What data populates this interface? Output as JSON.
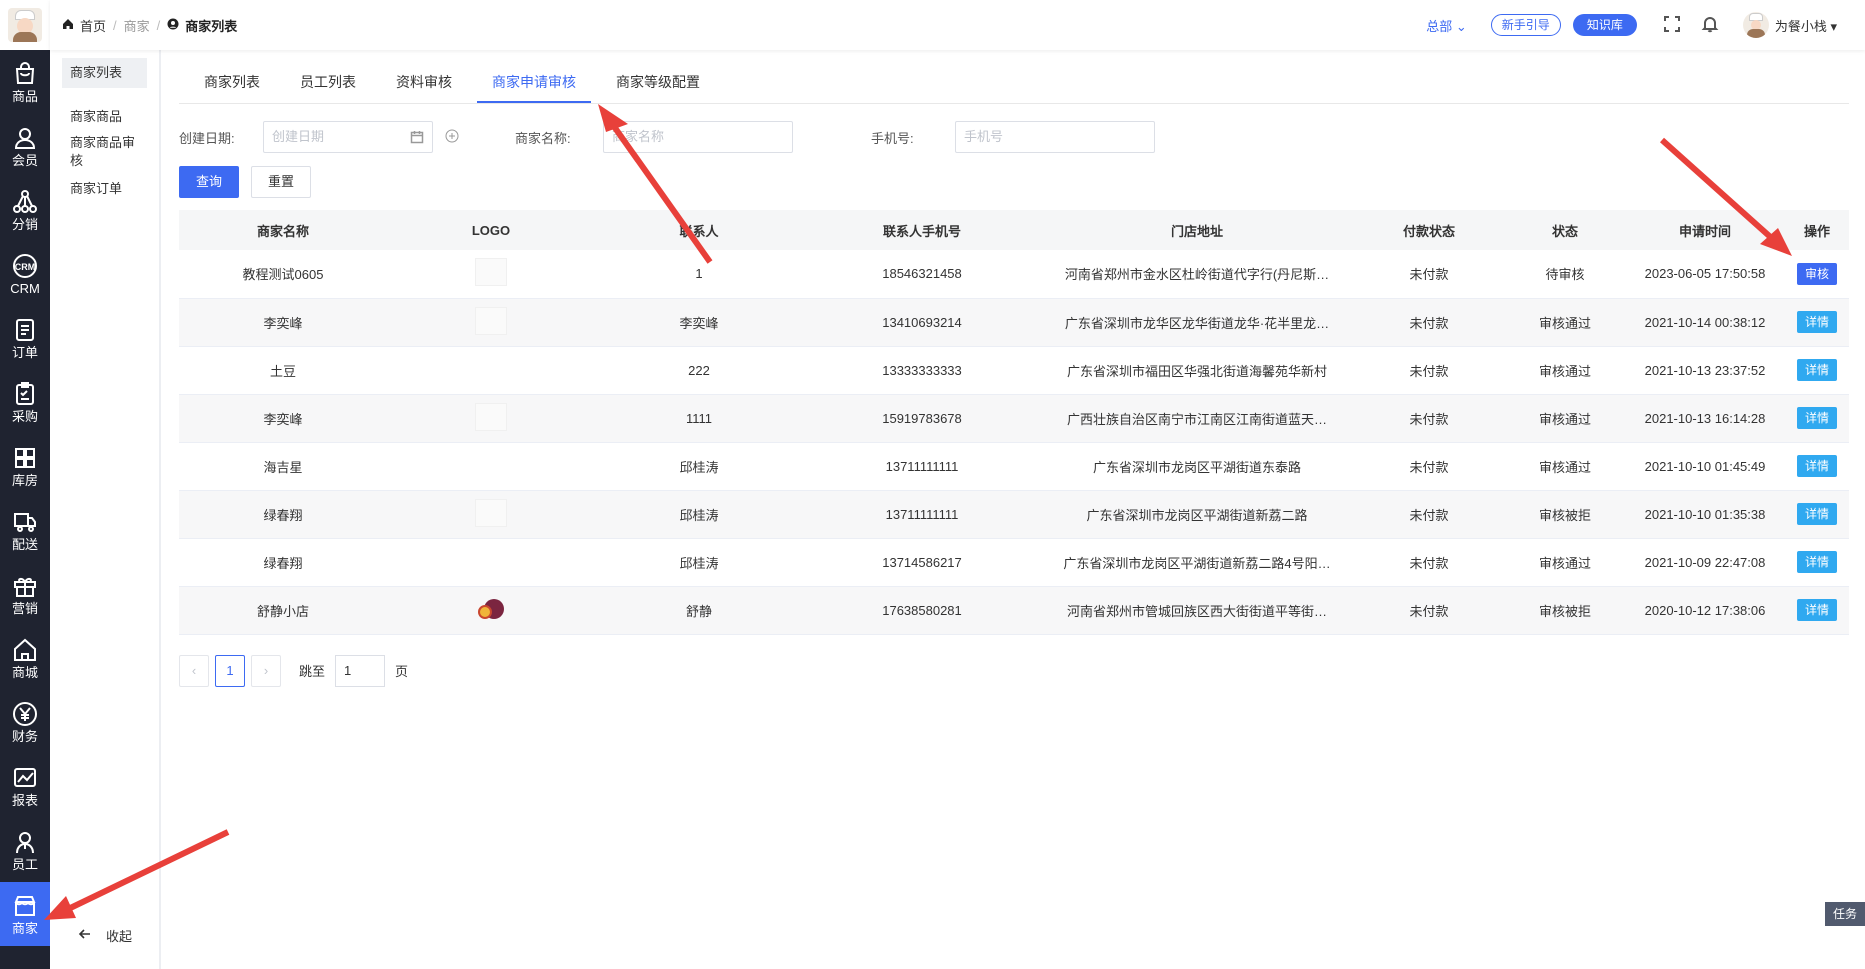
{
  "sidebar": {
    "items": [
      {
        "label": "商品",
        "icon": "bag-icon"
      },
      {
        "label": "会员",
        "icon": "user-icon"
      },
      {
        "label": "分销",
        "icon": "network-icon"
      },
      {
        "label": "CRM",
        "icon": "crm-icon"
      },
      {
        "label": "订单",
        "icon": "document-icon"
      },
      {
        "label": "采购",
        "icon": "clipboard-icon"
      },
      {
        "label": "库房",
        "icon": "boxes-icon"
      },
      {
        "label": "配送",
        "icon": "truck-icon"
      },
      {
        "label": "营销",
        "icon": "gift-icon"
      },
      {
        "label": "商城",
        "icon": "house-icon"
      },
      {
        "label": "财务",
        "icon": "yen-icon"
      },
      {
        "label": "报表",
        "icon": "chart-icon"
      },
      {
        "label": "员工",
        "icon": "staff-icon"
      },
      {
        "label": "商家",
        "icon": "store-icon",
        "active": true
      }
    ]
  },
  "subnav": {
    "items": [
      "商家列表",
      "商家商品",
      "商家商品审核",
      "商家订单"
    ],
    "collapse": "收起"
  },
  "breadcrumb": {
    "home": "首页",
    "level1": "商家",
    "current": "商家列表"
  },
  "topbar": {
    "branch": "总部",
    "guide": "新手引导",
    "knowledge": "知识库",
    "username": "为餐小栈"
  },
  "tabs": [
    "商家列表",
    "员工列表",
    "资料审核",
    "商家申请审核",
    "商家等级配置"
  ],
  "filters": {
    "date_label": "创建日期:",
    "date_placeholder": "创建日期",
    "name_label": "商家名称:",
    "name_placeholder": "商家名称",
    "phone_label": "手机号:",
    "phone_placeholder": "手机号"
  },
  "buttons": {
    "query": "查询",
    "reset": "重置"
  },
  "table": {
    "headers": [
      "商家名称",
      "LOGO",
      "联系人",
      "联系人手机号",
      "门店地址",
      "付款状态",
      "状态",
      "申请时间",
      "操作"
    ],
    "rows": [
      {
        "name": "教程测试0605",
        "logo": "placeholder",
        "contact": "1",
        "phone": "18546321458",
        "address": "河南省郑州市金水区杜岭街道代字行(丹尼斯…",
        "pay": "未付款",
        "status": "待审核",
        "time": "2023-06-05 17:50:58",
        "op": "审核"
      },
      {
        "name": "李奕峰",
        "logo": "placeholder",
        "contact": "李奕峰",
        "phone": "13410693214",
        "address": "广东省深圳市龙华区龙华街道龙华·花半里龙…",
        "pay": "未付款",
        "status": "审核通过",
        "time": "2021-10-14 00:38:12",
        "op": "详情"
      },
      {
        "name": "土豆",
        "logo": "none",
        "contact": "222",
        "phone": "13333333333",
        "address": "广东省深圳市福田区华强北街道海馨苑华新村",
        "pay": "未付款",
        "status": "审核通过",
        "time": "2021-10-13 23:37:52",
        "op": "详情"
      },
      {
        "name": "李奕峰",
        "logo": "placeholder",
        "contact": "1111",
        "phone": "15919783678",
        "address": "广西壮族自治区南宁市江南区江南街道蓝天…",
        "pay": "未付款",
        "status": "审核通过",
        "time": "2021-10-13 16:14:28",
        "op": "详情"
      },
      {
        "name": "海吉星",
        "logo": "none",
        "contact": "邱桂涛",
        "phone": "13711111111",
        "address": "广东省深圳市龙岗区平湖街道东泰路",
        "pay": "未付款",
        "status": "审核通过",
        "time": "2021-10-10 01:45:49",
        "op": "详情"
      },
      {
        "name": "绿春翔",
        "logo": "placeholder",
        "contact": "邱桂涛",
        "phone": "13711111111",
        "address": "广东省深圳市龙岗区平湖街道新荔二路",
        "pay": "未付款",
        "status": "审核被拒",
        "time": "2021-10-10 01:35:38",
        "op": "详情"
      },
      {
        "name": "绿春翔",
        "logo": "none",
        "contact": "邱桂涛",
        "phone": "13714586217",
        "address": "广东省深圳市龙岗区平湖街道新荔二路4号阳…",
        "pay": "未付款",
        "status": "审核通过",
        "time": "2021-10-09 22:47:08",
        "op": "详情"
      },
      {
        "name": "舒静小店",
        "logo": "fruit",
        "contact": "舒静",
        "phone": "17638580281",
        "address": "河南省郑州市管城回族区西大街街道平等街…",
        "pay": "未付款",
        "status": "审核被拒",
        "time": "2020-10-12 17:38:06",
        "op": "详情"
      }
    ]
  },
  "pagination": {
    "current": "1",
    "jump_label": "跳至",
    "jump_value": "1",
    "page_suffix": "页"
  },
  "task_badge": "任务",
  "colors": {
    "primary": "#3d6af2",
    "detail": "#30a9f0",
    "sidebar_bg": "#1f2330",
    "annotation_arrow": "#e8403a"
  }
}
